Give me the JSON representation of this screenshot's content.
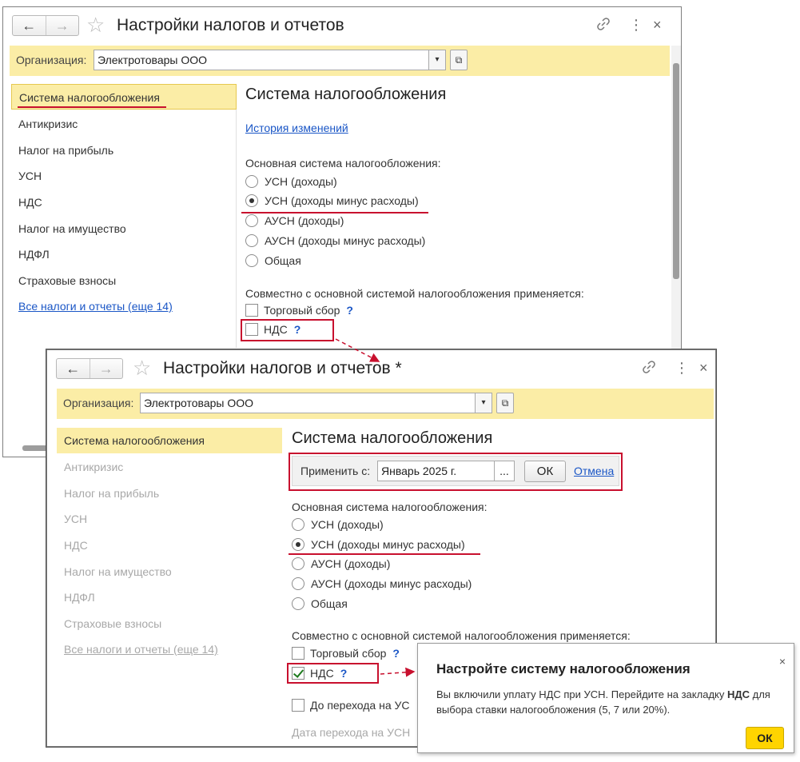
{
  "window1": {
    "title": "Настройки налогов и отчетов",
    "org_label": "Организация:",
    "org_value": "Электротовары ООО",
    "sidebar": {
      "items": [
        {
          "label": "Система налогообложения"
        },
        {
          "label": "Антикризис"
        },
        {
          "label": "Налог на прибыль"
        },
        {
          "label": "УСН"
        },
        {
          "label": "НДС"
        },
        {
          "label": "Налог на имущество"
        },
        {
          "label": "НДФЛ"
        },
        {
          "label": "Страховые взносы"
        }
      ],
      "all_link": "Все налоги и отчеты (еще 14)"
    },
    "section_title": "Система налогообложения",
    "history_link": "История изменений",
    "main_system_label": "Основная система налогообложения:",
    "radios": [
      {
        "label": "УСН (доходы)",
        "checked": false
      },
      {
        "label": "УСН (доходы минус расходы)",
        "checked": true
      },
      {
        "label": "АУСН (доходы)",
        "checked": false
      },
      {
        "label": "АУСН (доходы минус расходы)",
        "checked": false
      },
      {
        "label": "Общая",
        "checked": false
      }
    ],
    "combined_label": "Совместно с основной системой налогообложения применяется:",
    "checks": [
      {
        "label": "Торговый сбор",
        "help": "?",
        "checked": false
      },
      {
        "label": "НДС",
        "help": "?",
        "checked": false
      }
    ]
  },
  "window2": {
    "title": "Настройки налогов и отчетов *",
    "org_label": "Организация:",
    "org_value": "Электротовары ООО",
    "sidebar": {
      "items": [
        {
          "label": "Система налогообложения"
        },
        {
          "label": "Антикризис"
        },
        {
          "label": "Налог на прибыль"
        },
        {
          "label": "УСН"
        },
        {
          "label": "НДС"
        },
        {
          "label": "Налог на имущество"
        },
        {
          "label": "НДФЛ"
        },
        {
          "label": "Страховые взносы"
        }
      ],
      "all_link": "Все налоги и отчеты (еще 14)"
    },
    "section_title": "Система налогообложения",
    "apply_label": "Применить с:",
    "apply_value": "Январь 2025 г.",
    "apply_dots": "...",
    "ok_label": "ОК",
    "cancel_label": "Отмена",
    "main_system_label": "Основная система налогообложения:",
    "radios": [
      {
        "label": "УСН (доходы)",
        "checked": false
      },
      {
        "label": "УСН (доходы минус расходы)",
        "checked": true
      },
      {
        "label": "АУСН (доходы)",
        "checked": false
      },
      {
        "label": "АУСН (доходы минус расходы)",
        "checked": false
      },
      {
        "label": "Общая",
        "checked": false
      }
    ],
    "combined_label": "Совместно с основной системой налогообложения применяется:",
    "checks": [
      {
        "label": "Торговый сбор",
        "help": "?",
        "checked": false
      },
      {
        "label": "НДС",
        "help": "?",
        "checked": true
      },
      {
        "label": "До перехода на УС",
        "checked": false
      }
    ],
    "transition_date_label": "Дата перехода на УСН"
  },
  "popup": {
    "title": "Настройте систему налогообложения",
    "text_prefix": "Вы включили уплату НДС при УСН. Перейдите на закладку ",
    "text_bold": "НДС",
    "text_suffix": " для выбора ставки налогообложения (5, 7 или 20%).",
    "ok_label": "ОК",
    "close": "×"
  },
  "icons": {
    "back": "←",
    "forward": "→",
    "star": "☆",
    "link": "🔗",
    "more": "⋮",
    "close": "×",
    "dropdown": "▾",
    "open": "⧉"
  },
  "colors": {
    "highlight": "#fbeda6",
    "annotation_red": "#c8102e",
    "link_blue": "#1a56c6",
    "popup_ok": "#ffd400"
  }
}
